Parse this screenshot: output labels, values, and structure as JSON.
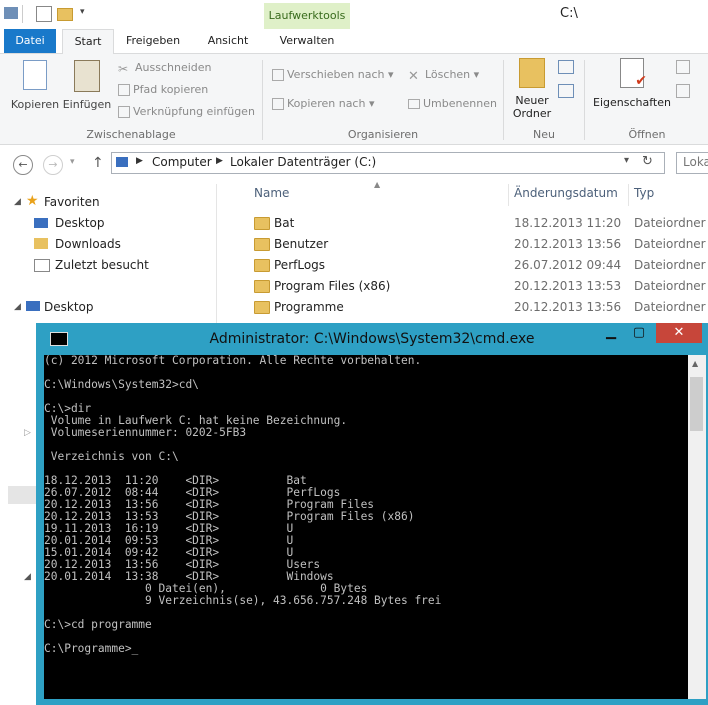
{
  "explorer": {
    "context_tab_group": "Laufwerktools",
    "title": "C:\\",
    "tabs": [
      "Datei",
      "Start",
      "Freigeben",
      "Ansicht",
      "Verwalten"
    ],
    "ribbon": {
      "kopieren": "Kopieren",
      "einfuegen": "Einfügen",
      "ausschneiden": "Ausschneiden",
      "pfad_kopieren": "Pfad kopieren",
      "verknuepfung": "Verknüpfung einfügen",
      "verschieben_nach": "Verschieben nach",
      "kopieren_nach": "Kopieren nach",
      "loeschen": "Löschen",
      "umbenennen": "Umbenennen",
      "neuer_ordner_1": "Neuer",
      "neuer_ordner_2": "Ordner",
      "eigenschaften": "Eigenschaften",
      "group_zwischenablage": "Zwischenablage",
      "group_organisieren": "Organisieren",
      "group_neu": "Neu",
      "group_oeffnen": "Öffnen"
    },
    "address": {
      "crumb_computer": "Computer",
      "crumb_drive": "Lokaler Datenträger (C:)",
      "search_placeholder": "Loka"
    },
    "nav": {
      "favoriten": "Favoriten",
      "desktop": "Desktop",
      "downloads": "Downloads",
      "zuletzt": "Zuletzt besucht",
      "desktop_root": "Desktop"
    },
    "columns": {
      "name": "Name",
      "date": "Änderungsdatum",
      "type": "Typ"
    },
    "files": [
      {
        "name": "Bat",
        "date": "18.12.2013 11:20",
        "type": "Dateiordner"
      },
      {
        "name": "Benutzer",
        "date": "20.12.2013 13:56",
        "type": "Dateiordner"
      },
      {
        "name": "PerfLogs",
        "date": "26.07.2012 09:44",
        "type": "Dateiordner"
      },
      {
        "name": "Program Files (x86)",
        "date": "20.12.2013 13:53",
        "type": "Dateiordner"
      },
      {
        "name": "Programme",
        "date": "20.12.2013 13:56",
        "type": "Dateiordner"
      }
    ]
  },
  "cmd": {
    "title": "Administrator: C:\\Windows\\System32\\cmd.exe",
    "minimize": "▁",
    "maximize": "▢",
    "close": "✕",
    "console_text": "(c) 2012 Microsoft Corporation. Alle Rechte vorbehalten.\n\nC:\\Windows\\System32>cd\\\n\nC:\\>dir\n Volume in Laufwerk C: hat keine Bezeichnung.\n Volumeseriennummer: 0202-5FB3\n\n Verzeichnis von C:\\\n\n18.12.2013  11:20    <DIR>          Bat\n26.07.2012  08:44    <DIR>          PerfLogs\n20.12.2013  13:56    <DIR>          Program Files\n20.12.2013  13:53    <DIR>          Program Files (x86)\n19.11.2013  16:19    <DIR>          U\n20.01.2014  09:53    <DIR>          U\n15.01.2014  09:42    <DIR>          U\n20.12.2013  13:56    <DIR>          Users\n20.01.2014  13:38    <DIR>          Windows\n               0 Datei(en),              0 Bytes\n               9 Verzeichnis(se), 43.656.757.248 Bytes frei\n\nC:\\>cd programme\n\nC:\\Programme>_"
  }
}
